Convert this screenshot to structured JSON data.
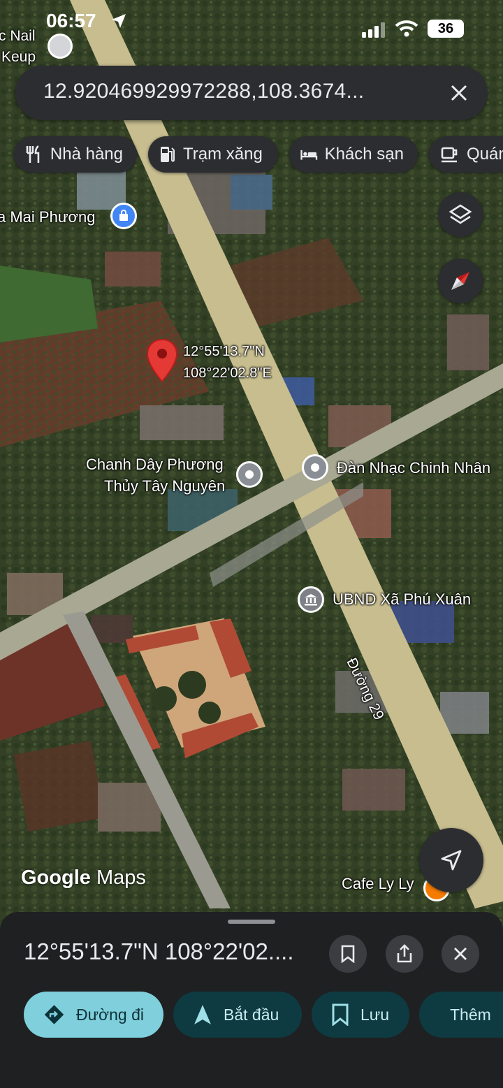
{
  "status_bar": {
    "time": "06:57",
    "battery": "36"
  },
  "search": {
    "query": "12.920469929972288,108.3674..."
  },
  "chips": [
    {
      "label": "Nhà hàng",
      "icon": "restaurant-icon"
    },
    {
      "label": "Trạm xăng",
      "icon": "gas-station-icon"
    },
    {
      "label": "Khách sạn",
      "icon": "hotel-icon"
    },
    {
      "label": "Quán",
      "icon": "cafe-icon"
    }
  ],
  "map": {
    "pin_coords": [
      "12°55'13.7\"N",
      "108°22'02.8\"E"
    ],
    "places": {
      "nail": [
        "c Nail",
        "Keup"
      ],
      "mai_phuong": "a Mai Phương",
      "chanh_day": [
        "Chanh Dây Phương",
        "Thủy Tây Nguyên"
      ],
      "dan_nhac": "Đàn Nhạc Chinh Nhân",
      "ubnd": "UBND Xã Phú Xuân",
      "cafe": "Cafe Ly Ly",
      "road": "Đường 29"
    },
    "attribution": {
      "google": "Google",
      "maps": "Maps"
    }
  },
  "sheet": {
    "title": "12°55'13.7\"N 108°22'02....",
    "actions": [
      {
        "label": "Đường đi",
        "icon": "directions-icon"
      },
      {
        "label": "Bắt đầu",
        "icon": "navigation-arrow-icon"
      },
      {
        "label": "Lưu",
        "icon": "bookmark-icon"
      },
      {
        "label": "Thêm",
        "icon": "flag-icon"
      }
    ]
  }
}
